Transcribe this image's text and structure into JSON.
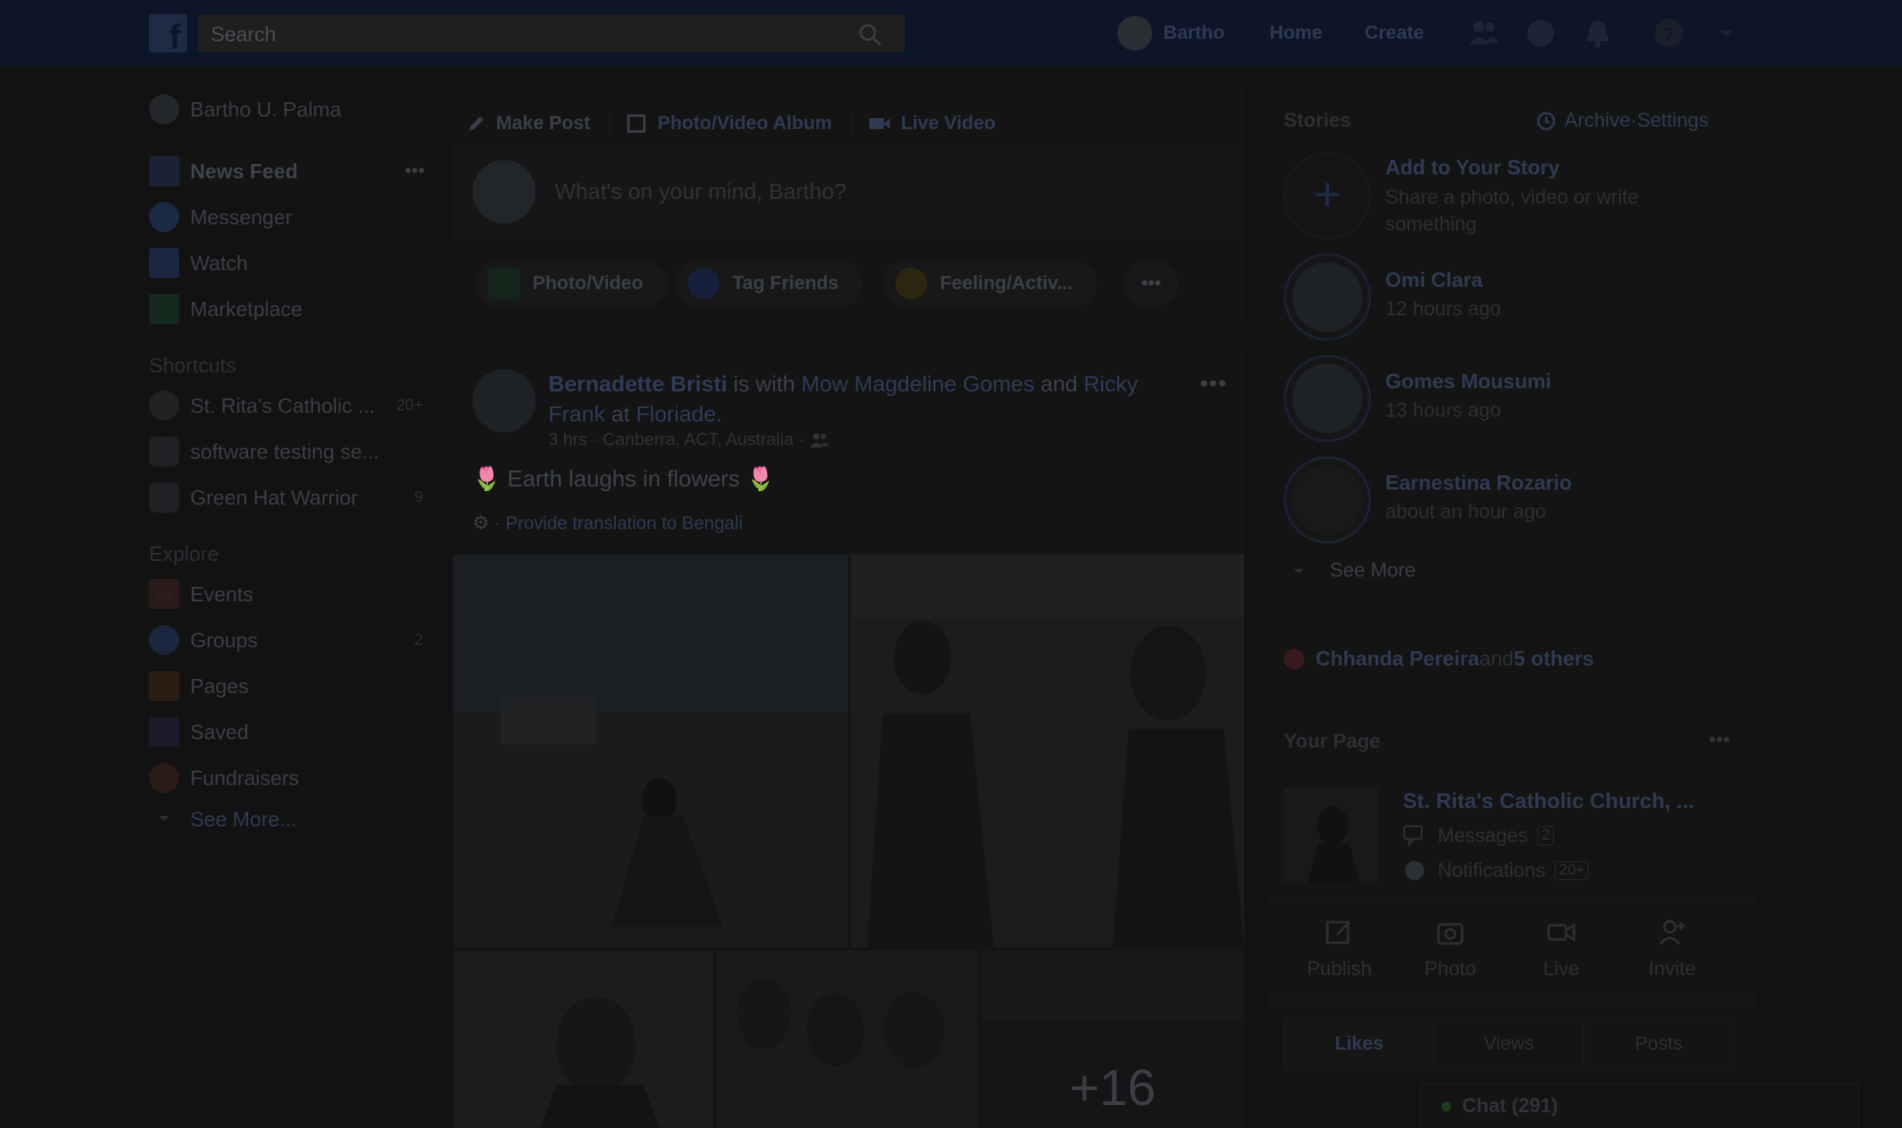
{
  "topbar": {
    "logo": "f",
    "search_placeholder": "Search",
    "user_name": "Bartho",
    "home_label": "Home",
    "create_label": "Create"
  },
  "sidebar": {
    "profile_name": "Bartho U. Palma",
    "main_items": [
      {
        "label": "News Feed",
        "icon": "news-feed-icon",
        "more": "•••"
      },
      {
        "label": "Messenger",
        "icon": "messenger-icon"
      },
      {
        "label": "Watch",
        "icon": "watch-icon"
      },
      {
        "label": "Marketplace",
        "icon": "marketplace-icon"
      }
    ],
    "shortcuts_heading": "Shortcuts",
    "shortcuts": [
      {
        "label": "St. Rita's Catholic ...",
        "count": "20+"
      },
      {
        "label": "software testing se...",
        "count": ""
      },
      {
        "label": "Green Hat Warrior",
        "count": "9"
      }
    ],
    "explore_heading": "Explore",
    "explore": [
      {
        "label": "Events",
        "count": "",
        "icon_text": "26"
      },
      {
        "label": "Groups",
        "count": "2"
      },
      {
        "label": "Pages",
        "count": ""
      },
      {
        "label": "Saved",
        "count": ""
      },
      {
        "label": "Fundraisers",
        "count": ""
      }
    ],
    "see_more": "See More..."
  },
  "composer": {
    "tabs": [
      "Make Post",
      "Photo/Video Album",
      "Live Video"
    ],
    "placeholder": "What's on your mind, Bartho?",
    "actions": [
      "Photo/Video",
      "Tag Friends",
      "Feeling/Activ...",
      "•••"
    ]
  },
  "post": {
    "author": "Bernadette Bristi",
    "with_text": " is with ",
    "tagged1": "Mow Magdeline Gomes",
    "and_text": " and ",
    "tagged2": "Ricky Frank",
    "at_text": " at ",
    "place": "Floriade",
    "period": ".",
    "meta": "3 hrs · Canberra, ACT, Australia · ",
    "more": "•••",
    "text": "Earth laughs in flowers",
    "emoji_left": "🌷",
    "emoji_right": "🌷",
    "translation": "· Provide translation to Bengali",
    "more_photos": "+16"
  },
  "stories": {
    "title": "Stories",
    "archive": "Archive",
    "separator": " · ",
    "settings": "Settings",
    "add_title": "Add to Your Story",
    "add_sub": "Share a photo, video or write something",
    "items": [
      {
        "name": "Omi Clara",
        "time": "12 hours ago"
      },
      {
        "name": "Gomes Mousumi",
        "time": "13 hours ago"
      },
      {
        "name": "Earnestina Rozario",
        "time": "about an hour ago"
      }
    ],
    "see_more": "See More"
  },
  "likes_line": {
    "name": "Chhanda Pereira",
    "and_text": " and ",
    "others": "5 others"
  },
  "your_page": {
    "title": "Your Page",
    "more": "•••",
    "page_name": "St. Rita's Catholic Church, ...",
    "messages_label": "Messages",
    "messages_count": "2",
    "notifications_label": "Notifications",
    "notifications_count": "20+",
    "actions": [
      "Publish",
      "Photo",
      "Live",
      "Invite"
    ],
    "tabs": [
      "Likes",
      "Views",
      "Posts"
    ]
  },
  "chat": {
    "label": "Chat (291)"
  },
  "colors": {
    "overlay_background": "#121212",
    "topbar": "#0d1628",
    "link_dim": "#2f3a52"
  }
}
